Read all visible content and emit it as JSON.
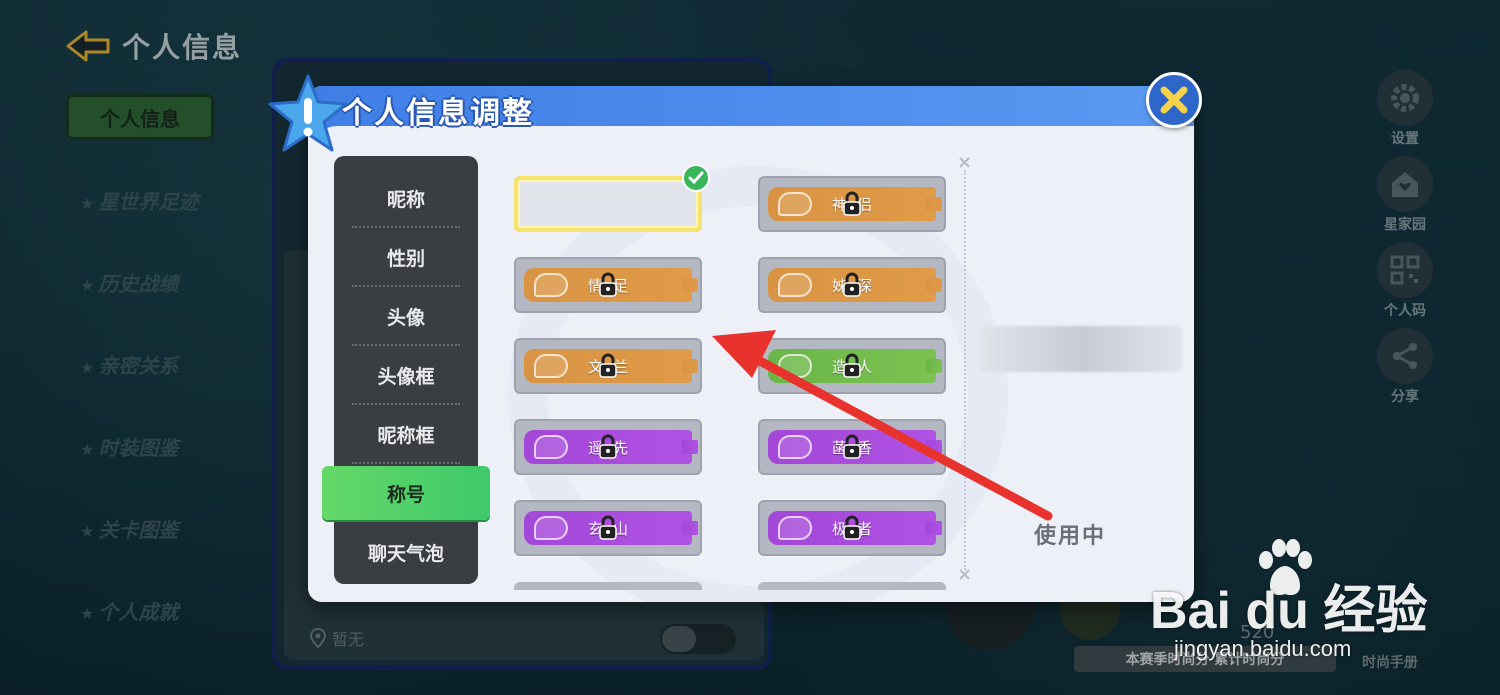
{
  "background": {
    "header_title": "个人信息",
    "active_tab": "个人信息",
    "nav_items": [
      "星世界足迹",
      "历史战绩",
      "亲密关系",
      "时装图鉴",
      "关卡图鉴",
      "个人成就"
    ],
    "location_label": "暂无",
    "right_rail": [
      {
        "label": "设置",
        "icon": "gear-icon"
      },
      {
        "label": "星家园",
        "icon": "home-icon"
      },
      {
        "label": "个人码",
        "icon": "qr-icon"
      },
      {
        "label": "分享",
        "icon": "share-icon"
      }
    ],
    "stats_label": "本赛季时尚分  累计时尚分",
    "stats_number": "520",
    "handbook_label": "时尚手册"
  },
  "modal": {
    "title": "个人信息调整",
    "categories": [
      "昵称",
      "性别",
      "头像",
      "头像框",
      "昵称框",
      "称号",
      "聊天气泡"
    ],
    "active_category": "称号",
    "titles": [
      {
        "label": "神侣",
        "color": "orange",
        "locked": true
      },
      {
        "label": "情足",
        "color": "orange",
        "locked": true
      },
      {
        "label": "姊深",
        "color": "orange",
        "locked": true
      },
      {
        "label": "文兰",
        "color": "orange",
        "locked": true
      },
      {
        "label": "造人",
        "color": "green",
        "locked": true
      },
      {
        "label": "遥先",
        "color": "purple",
        "locked": true
      },
      {
        "label": "菡香",
        "color": "purple",
        "locked": true
      },
      {
        "label": "玄山",
        "color": "purple",
        "locked": true
      },
      {
        "label": "极者",
        "color": "purple",
        "locked": true
      }
    ],
    "in_use_label": "使用中"
  },
  "watermark": {
    "brand": "Bai du 经验",
    "url": "jingyan.baidu.com"
  },
  "colors": {
    "modal_header": "#3f7ee6",
    "active_category": "#4fd36a",
    "selected_border": "#f6e36d",
    "annotation_arrow": "#e8322e"
  }
}
